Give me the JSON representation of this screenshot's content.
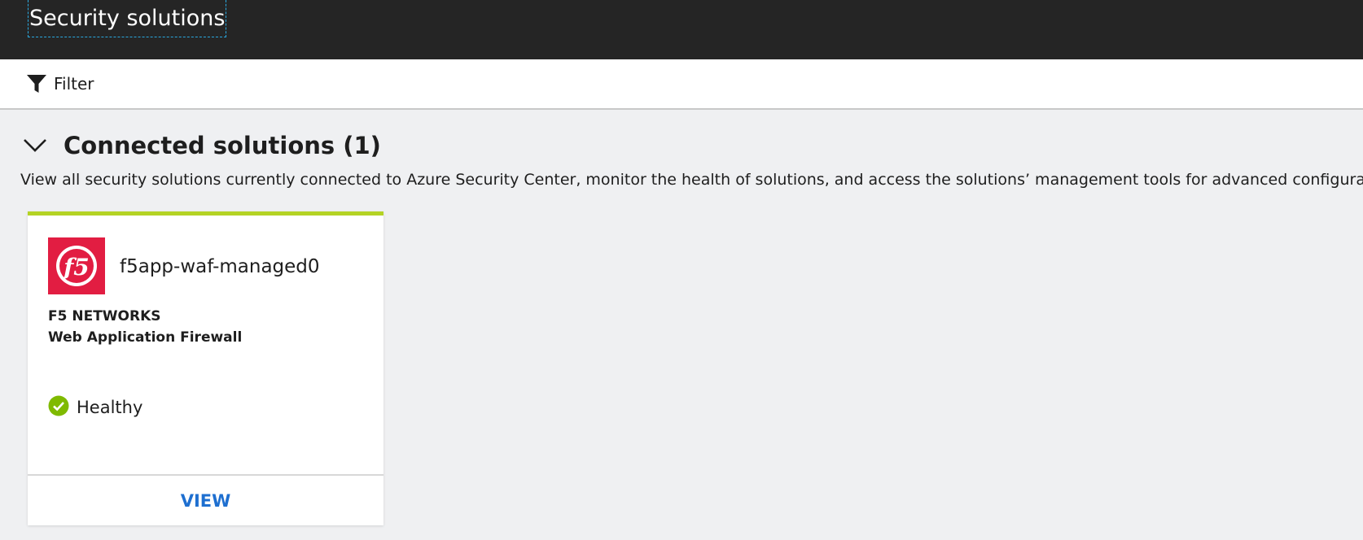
{
  "header": {
    "title": "Security solutions"
  },
  "toolbar": {
    "filter_label": "Filter",
    "filter_icon": "funnel-icon"
  },
  "section": {
    "title": "Connected solutions (1)",
    "collapse_icon": "chevron-down-icon",
    "description": "View all security solutions currently connected to Azure Security Center, monitor the health of solutions, and access the solutions’ management tools for advanced configuration."
  },
  "cards": [
    {
      "name": "f5app-waf-managed0",
      "logo_icon": "f5-logo",
      "logo_color": "#e21d42",
      "vendor": "F5 NETWORKS",
      "solution_type": "Web Application Firewall",
      "status": "Healthy",
      "status_icon": "check-circle-icon",
      "status_color": "#7fba00",
      "accent_color": "#b4d324",
      "action_label": "VIEW"
    }
  ]
}
